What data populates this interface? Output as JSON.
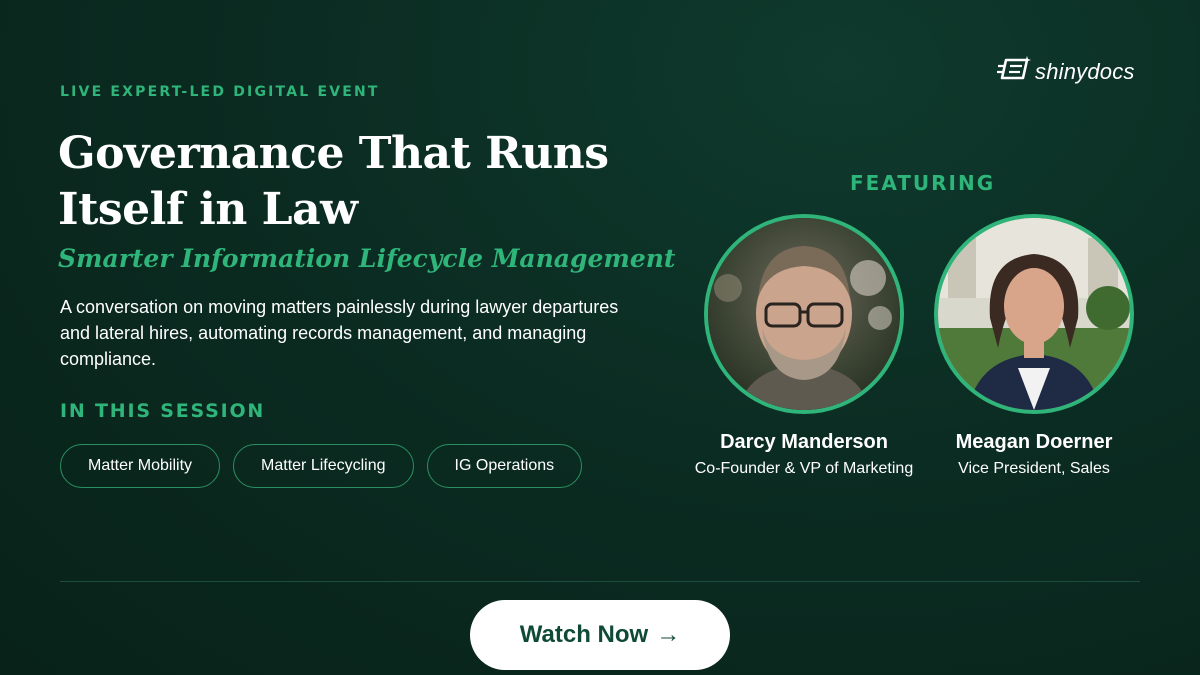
{
  "event": {
    "eyebrow": "LIVE EXPERT-LED DIGITAL EVENT",
    "title": "Governance That Runs Itself in Law",
    "subtitle": "Smarter Information Lifecycle Management",
    "description": "A conversation on moving matters painlessly during lawyer departures and lateral hires, automating records management, and managing compliance."
  },
  "session": {
    "heading": "IN THIS SESSION",
    "topics": [
      "Matter Mobility",
      "Matter Lifecycling",
      "IG Operations"
    ]
  },
  "brand": {
    "logo_text": "shinydocs",
    "logo_icon": "shinydocs-logo-icon",
    "accent_color": "#2fb57a",
    "background_color": "#0b2c22"
  },
  "featuring": {
    "heading": "FEATURING",
    "speakers": [
      {
        "name": "Darcy Manderson",
        "role": "Co-Founder & VP of Marketing"
      },
      {
        "name": "Meagan Doerner",
        "role": "Vice President, Sales"
      }
    ]
  },
  "cta": {
    "label": "Watch Now",
    "arrow": "→"
  }
}
